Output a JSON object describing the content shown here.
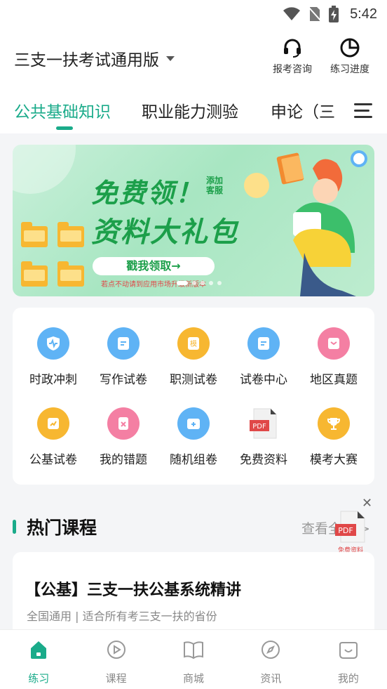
{
  "status_bar": {
    "time": "5:42",
    "icons": [
      "wifi-icon",
      "no-sim-icon",
      "battery-charging-icon"
    ]
  },
  "header": {
    "title": "三支一扶考试通用版",
    "actions": [
      {
        "label": "报考咨询",
        "icon": "headset-icon"
      },
      {
        "label": "练习进度",
        "icon": "pie-chart-icon"
      }
    ]
  },
  "tabs": {
    "items": [
      "公共基础知识",
      "职业能力测验",
      "申论（三"
    ],
    "active_index": 0,
    "menu_icon": "hamburger-menu-icon"
  },
  "banner": {
    "headline": "免费领！",
    "tag": "添加客服",
    "subhead": "资料大礼包",
    "button": "戳我领取→",
    "note": "若点不动请到应用市场升级新版本",
    "page_count": 5,
    "current_page": 0
  },
  "grid": {
    "items": [
      {
        "label": "时政冲刺",
        "icon": "shield-pulse-icon",
        "color": "#5fb3f5"
      },
      {
        "label": "写作试卷",
        "icon": "document-icon",
        "color": "#5fb3f5"
      },
      {
        "label": "职测试卷",
        "icon": "mock-exam-icon",
        "color": "#f7b731"
      },
      {
        "label": "试卷中心",
        "icon": "document-icon",
        "color": "#5fb3f5"
      },
      {
        "label": "地区真题",
        "icon": "chat-card-icon",
        "color": "#f47fa3"
      },
      {
        "label": "公基试卷",
        "icon": "trend-card-icon",
        "color": "#f7b731"
      },
      {
        "label": "我的错题",
        "icon": "error-note-icon",
        "color": "#f47fa3"
      },
      {
        "label": "随机组卷",
        "icon": "add-folder-icon",
        "color": "#5fb3f5"
      },
      {
        "label": "免费资料",
        "icon": "pdf-file-icon",
        "color": "#e04848"
      },
      {
        "label": "模考大赛",
        "icon": "trophy-icon",
        "color": "#f7b731"
      }
    ]
  },
  "hot_courses": {
    "title": "热门课程",
    "more": "查看全部 >",
    "floating_badge": "免费资料",
    "courses": [
      {
        "title": "【公基】三支一扶公基系统精讲",
        "subtitle": "全国通用 | 适合所有考三支一扶的省份"
      }
    ]
  },
  "bottom_nav": {
    "items": [
      {
        "label": "练习",
        "icon": "home-icon"
      },
      {
        "label": "课程",
        "icon": "play-circle-icon"
      },
      {
        "label": "商城",
        "icon": "book-open-icon"
      },
      {
        "label": "资讯",
        "icon": "compass-icon"
      },
      {
        "label": "我的",
        "icon": "smile-icon"
      }
    ],
    "active_index": 0
  },
  "colors": {
    "accent": "#1aab8a",
    "banner_green": "#1c9f4a"
  }
}
